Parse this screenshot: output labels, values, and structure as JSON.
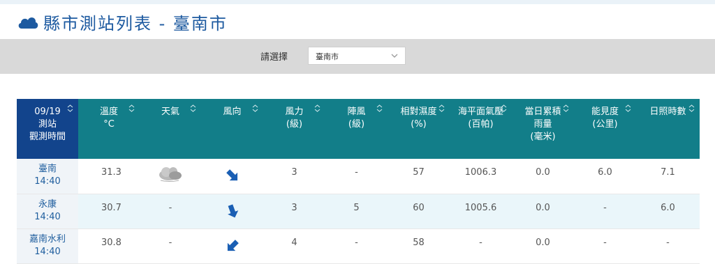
{
  "title": "縣市測站列表 - 臺南市",
  "selector": {
    "label": "請選擇",
    "value": "臺南市"
  },
  "table": {
    "headers": {
      "time": [
        "09/19",
        "測站",
        "觀測時間"
      ],
      "temp": [
        "溫度",
        "°C"
      ],
      "weather": [
        "天氣"
      ],
      "wind_dir": [
        "風向"
      ],
      "wind_force": [
        "風力",
        "(級)"
      ],
      "gust": [
        "陣風",
        "(級)"
      ],
      "humidity": [
        "相對濕度",
        "(%)"
      ],
      "pressure": [
        "海平面氣壓",
        "(百帕)"
      ],
      "rain": [
        "當日累積",
        "雨量",
        "(毫米)"
      ],
      "visibility": [
        "能見度",
        "(公里)"
      ],
      "sunshine": [
        "日照時數"
      ]
    },
    "rows": [
      {
        "station": "臺南",
        "time": "14:40",
        "temp": "31.3",
        "weather": "cloudy-icon",
        "weather_text": "",
        "wind_dir_deg": 135,
        "wind_force": "3",
        "gust": "-",
        "humidity": "57",
        "pressure": "1006.3",
        "rain": "0.0",
        "visibility": "6.0",
        "sunshine": "7.1"
      },
      {
        "station": "永康",
        "time": "14:40",
        "temp": "30.7",
        "weather": "",
        "weather_text": "-",
        "wind_dir_deg": 160,
        "wind_force": "3",
        "gust": "5",
        "humidity": "60",
        "pressure": "1005.6",
        "rain": "0.0",
        "visibility": "-",
        "sunshine": "6.0"
      },
      {
        "station": "嘉南水利",
        "time": "14:40",
        "temp": "30.8",
        "weather": "",
        "weather_text": "-",
        "wind_dir_deg": 225,
        "wind_force": "4",
        "gust": "-",
        "humidity": "58",
        "pressure": "-",
        "rain": "0.0",
        "visibility": "-",
        "sunshine": "-"
      }
    ]
  },
  "colors": {
    "header_teal": "#127e89",
    "header_navy": "#12448c",
    "title_blue": "#1d5aa0",
    "arrow_blue": "#1a5fb4"
  }
}
